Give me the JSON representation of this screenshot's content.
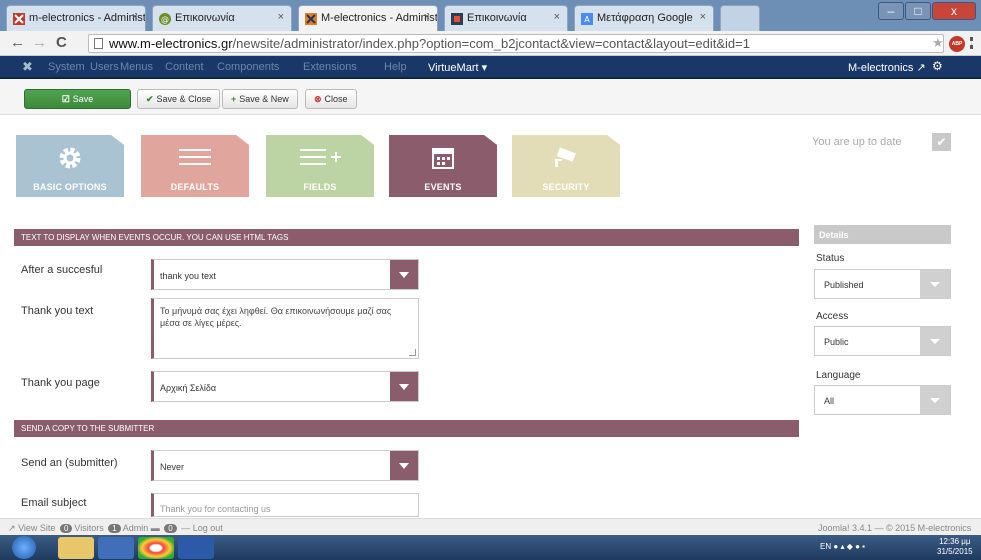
{
  "browser": {
    "tabs": [
      {
        "title": "m-electronics - Administr",
        "active": false
      },
      {
        "title": "Επικοινωνία",
        "active": false
      },
      {
        "title": "M-electronics - Administr",
        "active": true
      },
      {
        "title": "Επικοινωνία",
        "active": false
      },
      {
        "title": "Μετάφραση Google",
        "active": false
      }
    ],
    "tab_close": "×",
    "window_controls": {
      "minimize": "–",
      "maximize": "□",
      "close": "x"
    },
    "nav": {
      "back": "←",
      "forward": "→",
      "reload": "C"
    },
    "url_domain": "www.m-electronics.gr",
    "url_path": "/newsite/administrator/index.php?option=com_b2jcontact&view=contact&layout=edit&id=1",
    "star": "★",
    "abp": "ABP"
  },
  "adminnav": {
    "logo": "✖",
    "menu": [
      "System",
      "Users",
      "Menus",
      "Content",
      "Components",
      "Extensions",
      "Help"
    ],
    "virtuemart": "VirtueMart ▾",
    "site_name": "M-electronics ↗",
    "gear": "⚙"
  },
  "toolbar": {
    "save": "Save",
    "save_close": "Save & Close",
    "save_new": "Save & New",
    "close": "Close",
    "save_icon": "☑",
    "save_close_icon": "✔",
    "save_new_icon": "+",
    "close_icon": "⊗"
  },
  "tiles": [
    {
      "label": "BASIC OPTIONS",
      "icon": "gear-icon",
      "color": "#a9c3d3"
    },
    {
      "label": "DEFAULTS",
      "icon": "list-icon",
      "color": "#e0a69e"
    },
    {
      "label": "FIELDS",
      "icon": "list-add-icon",
      "color": "#bcd3a3"
    },
    {
      "label": "EVENTS",
      "icon": "calendar-icon",
      "color": "#8a5c6c"
    },
    {
      "label": "SECURITY",
      "icon": "camera-icon",
      "color": "#e3ddb7"
    }
  ],
  "update_status": "You are up to date",
  "update_check": "✔",
  "sections": {
    "events_header": "TEXT TO DISPLAY WHEN EVENTS OCCUR. YOU CAN USE HTML TAGS",
    "copy_header": "SEND A COPY TO THE SUBMITTER"
  },
  "fields": {
    "after_label": "After a succesful",
    "after_value": "thank you text",
    "thankyou_text_label": "Thank you text",
    "thankyou_text_value": "Το μήνυμά σας έχει ληφθεί. Θα επικοινωνήσουμε μαζί σας μέσα σε λίγες μέρες.",
    "thankyou_page_label": "Thank you page",
    "thankyou_page_value": "Αρχική Σελίδα",
    "send_label": "Send an (submitter)",
    "send_value": "Never",
    "email_subject_label": "Email subject",
    "email_subject_placeholder": "Thank you for contacting us"
  },
  "details": {
    "heading": "Details",
    "status_label": "Status",
    "status_value": "Published",
    "access_label": "Access",
    "access_value": "Public",
    "language_label": "Language",
    "language_value": "All"
  },
  "statusbar": {
    "view_site": "View Site",
    "visitors_count": "0",
    "visitors": "Visitors",
    "admin_count": "1",
    "admin": "Admin",
    "messages_count": "0",
    "logout": "Log out",
    "version": "Joomla! 3.4.1 — © 2015 M-electronics"
  },
  "taskbar": {
    "lang": "EN",
    "time": "12:36 μμ",
    "date": "31/5/2015"
  }
}
